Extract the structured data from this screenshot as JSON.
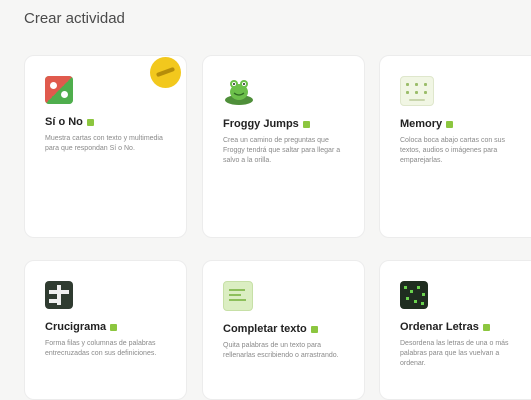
{
  "page": {
    "title": "Crear actividad"
  },
  "cards": [
    {
      "title": "Sí o No",
      "desc": "Muestra cartas con texto y multimedia para que respondan Sí o No.",
      "icon": "yes-no-thumbnail"
    },
    {
      "title": "Froggy Jumps",
      "desc": "Crea un camino de preguntas que Froggy tendrá que saltar para llegar a salvo a la orilla.",
      "icon": "frog-thumbnail"
    },
    {
      "title": "Memory",
      "desc": "Coloca boca abajo cartas con sus textos, audios o imágenes para emparejarlas.",
      "icon": "memory-thumbnail"
    },
    {
      "title": "Crucigrama",
      "desc": "Forma filas y columnas de palabras entrecruzadas con sus definiciones.",
      "icon": "crossword-thumbnail"
    },
    {
      "title": "Completar texto",
      "desc": "Quita palabras de un texto para rellenarlas escribiendo o arrastrando.",
      "icon": "fill-text-thumbnail"
    },
    {
      "title": "Ordenar Letras",
      "desc": "Desordena las letras de una o más palabras para que las vuelvan a ordenar.",
      "icon": "order-letters-thumbnail"
    }
  ],
  "colors": {
    "ai_badge": "#8cc63f",
    "new_badge": "#f2c81d"
  }
}
